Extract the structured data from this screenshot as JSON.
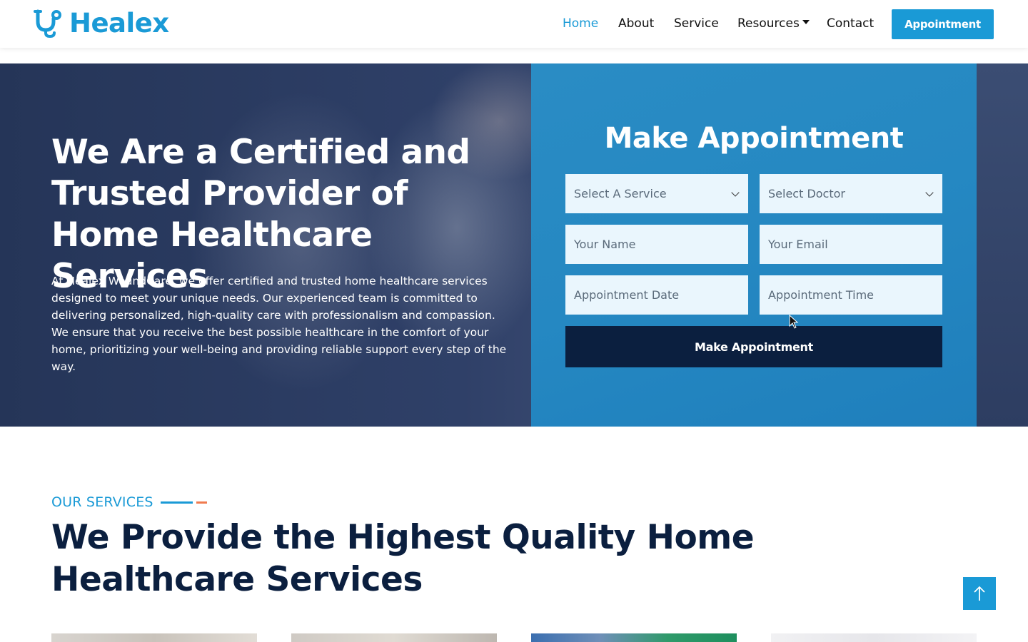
{
  "brand": {
    "name": "Healex",
    "logo_icon": "stethoscope-icon",
    "accent_color": "#1a9ad6"
  },
  "nav": {
    "items": [
      {
        "label": "Home",
        "active": true
      },
      {
        "label": "About",
        "active": false
      },
      {
        "label": "Service",
        "active": false
      },
      {
        "label": "Resources",
        "active": false,
        "dropdown": true
      },
      {
        "label": "Contact",
        "active": false
      }
    ],
    "cta_label": "Appointment"
  },
  "hero": {
    "title": "We Are a Certified and Trusted Provider of Home Healthcare Services",
    "text": "At Healex WoundCare, we offer certified and trusted home healthcare services designed to meet your unique needs. Our experienced team is committed to delivering personalized, high-quality care with professionalism and compassion. We ensure that you receive the best possible healthcare in the comfort of your home, prioritizing your well-being and providing reliable support every step of the way."
  },
  "appointment_form": {
    "title": "Make Appointment",
    "service_select": "Select A Service",
    "doctor_select": "Select Doctor",
    "name_placeholder": "Your Name",
    "email_placeholder": "Your Email",
    "date_placeholder": "Appointment Date",
    "time_placeholder": "Appointment Time",
    "submit_label": "Make Appointment",
    "panel_color": "#2588c2",
    "button_color": "#0b1f3f"
  },
  "services": {
    "eyebrow": "OUR SERVICES",
    "title": "We Provide the Highest Quality Home Healthcare Services",
    "underline_colors": [
      "#1a9ad6",
      "#f07b4f"
    ]
  },
  "scroll_top": {
    "icon": "arrow-up-icon"
  }
}
